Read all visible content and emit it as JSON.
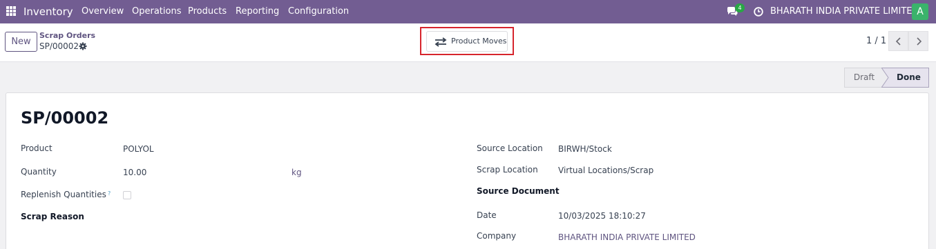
{
  "topbar": {
    "app_name": "Inventory",
    "menu": [
      "Overview",
      "Operations",
      "Products",
      "Reporting",
      "Configuration"
    ],
    "chat_count": "4",
    "company": "BHARATH INDIA PRIVATE LIMITED",
    "avatar_letter": "A",
    "icons": [
      "apps-grid-icon",
      "chat-icon",
      "clock-icon"
    ]
  },
  "control": {
    "new_label": "New",
    "breadcrumb_parent": "Scrap Orders",
    "record_name": "SP/00002",
    "smart_button_label": "Product Moves",
    "pager": "1 / 1",
    "icons": [
      "gear-icon",
      "transfer-icon",
      "chevron-left-icon",
      "chevron-right-icon"
    ]
  },
  "status": {
    "stages": [
      "Draft",
      "Done"
    ],
    "active": "Done"
  },
  "form": {
    "title": "SP/00002",
    "product_label": "Product",
    "product_value": "POLYOL",
    "quantity_label": "Quantity",
    "quantity_value": "10.00",
    "uom_value": "kg",
    "replenish_label": "Replenish Quantities",
    "replenish_help": "?",
    "scrap_reason_label": "Scrap Reason",
    "source_location_label": "Source Location",
    "source_location_value": "BIRWH/Stock",
    "scrap_location_label": "Scrap Location",
    "scrap_location_value": "Virtual Locations/Scrap",
    "source_document_label": "Source Document",
    "date_label": "Date",
    "date_value": "10/03/2025 18:10:27",
    "company_label": "Company",
    "company_value": "BHARATH INDIA PRIVATE LIMITED"
  },
  "colors": {
    "navbar": "#725d92",
    "accent": "#5f5480",
    "highlight": "#d6242c",
    "badge": "#28a745",
    "avatar": "#3ab36b"
  }
}
